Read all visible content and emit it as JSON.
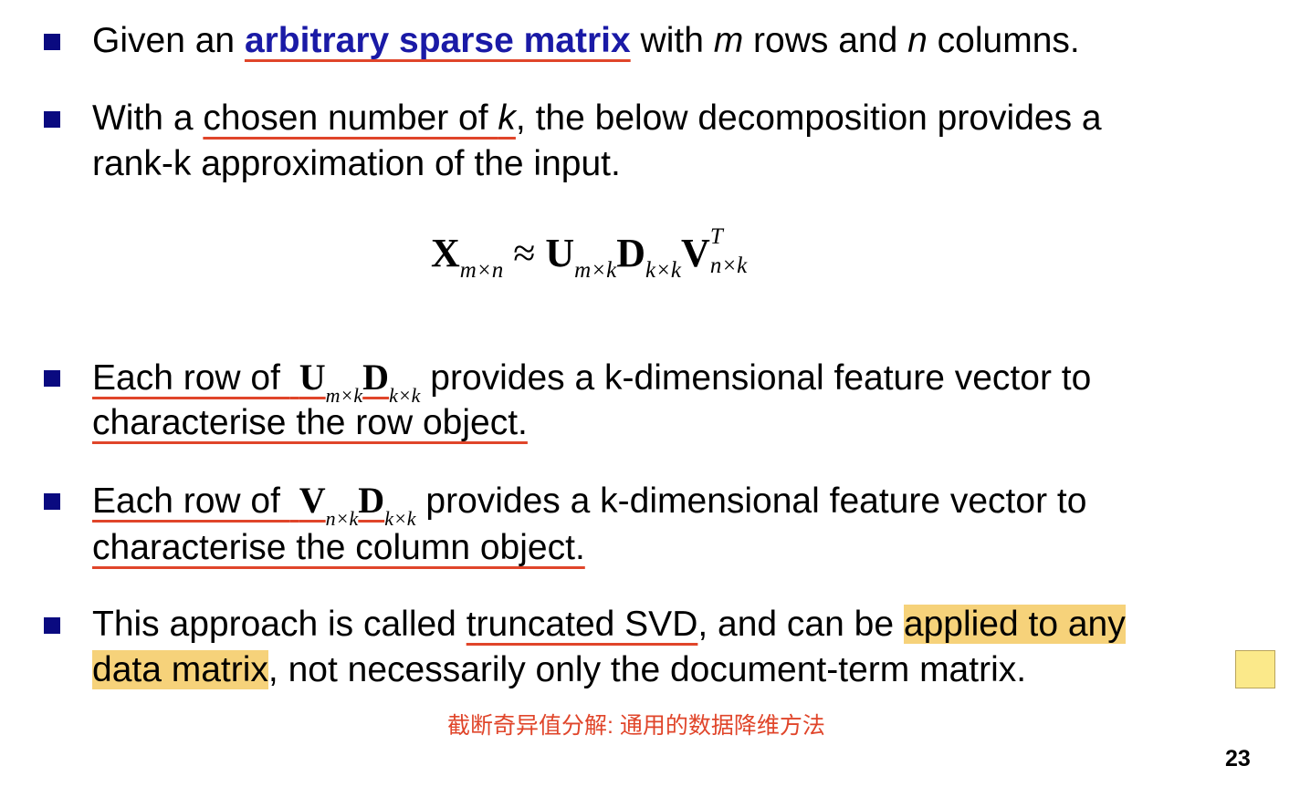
{
  "bullets": {
    "b1": {
      "text_a": "Given an ",
      "emph": "arbitrary sparse matrix",
      "text_b": " with ",
      "var_m": "m",
      "text_c": " rows and ",
      "var_n": "n",
      "text_d": " columns."
    },
    "b2": {
      "u_text": "chosen number of ",
      "var_k": "k",
      "text_a": "With a ",
      "text_b": ", the below decomposition provides a",
      "line2": "rank-k approximation of the input."
    },
    "equation": {
      "X": "X",
      "X_sub": "m×n",
      "approx": " ≈ ",
      "U": "U",
      "U_sub": "m×k",
      "D": "D",
      "D_sub": "k×k",
      "V": "V",
      "V_sup": "T",
      "V_sub": "n×k"
    },
    "b3": {
      "text_a": "Each row of ",
      "U": "U",
      "U_sub": "m×k",
      "D": "D",
      "D_sub": "k×k",
      "text_b": " provides a k-dimensional feature vector to",
      "line2": "characterise the row object."
    },
    "b4": {
      "text_a": "Each row of ",
      "V": "V",
      "V_sub": "n×k",
      "D": "D",
      "D_sub": "k×k",
      "text_b": " provides a k-dimensional feature vector to",
      "line2": "characterise the column object."
    },
    "b5": {
      "text_a": "This approach is called ",
      "u_text": "truncated SVD",
      "text_b": ", and can be ",
      "hl1": "applied to any",
      "hl2": "data matrix",
      "text_c": ", not necessarily only the document-term matrix."
    }
  },
  "note": "截断奇异值分解: 通用的数据降维方法",
  "page_number": "23",
  "colors": {
    "bullet": "#0a0a80",
    "emphasis_blue": "#1a1aa6",
    "underline_red": "#e0452a",
    "highlight": "#f6d27a",
    "sticky_note": "#fbe98a"
  }
}
